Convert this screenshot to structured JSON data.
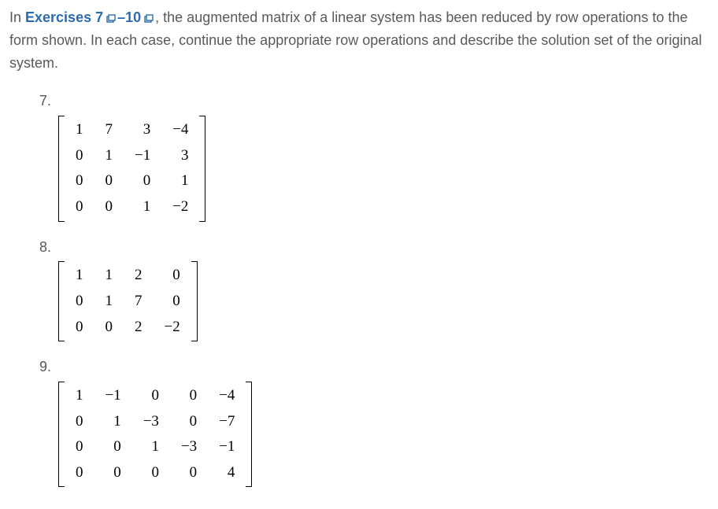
{
  "instruction": {
    "prefix": "In ",
    "exercises_label": "Exercises 7",
    "dash": "–10",
    "rest": ", the augmented matrix of a linear system has been reduced by row operations to the form shown. In each case, continue the appropriate row operations and describe the solution set of the original system."
  },
  "exercises": [
    {
      "number": "7.",
      "matrix": [
        [
          "1",
          "7",
          "3",
          "−4"
        ],
        [
          "0",
          "1",
          "−1",
          "3"
        ],
        [
          "0",
          "0",
          "0",
          "1"
        ],
        [
          "0",
          "0",
          "1",
          "−2"
        ]
      ]
    },
    {
      "number": "8.",
      "matrix": [
        [
          "1",
          "1",
          "2",
          "0"
        ],
        [
          "0",
          "1",
          "7",
          "0"
        ],
        [
          "0",
          "0",
          "2",
          "−2"
        ]
      ]
    },
    {
      "number": "9.",
      "matrix": [
        [
          "1",
          "−1",
          "0",
          "0",
          "−4"
        ],
        [
          "0",
          "1",
          "−3",
          "0",
          "−7"
        ],
        [
          "0",
          "0",
          "1",
          "−3",
          "−1"
        ],
        [
          "0",
          "0",
          "0",
          "0",
          "4"
        ]
      ]
    }
  ]
}
